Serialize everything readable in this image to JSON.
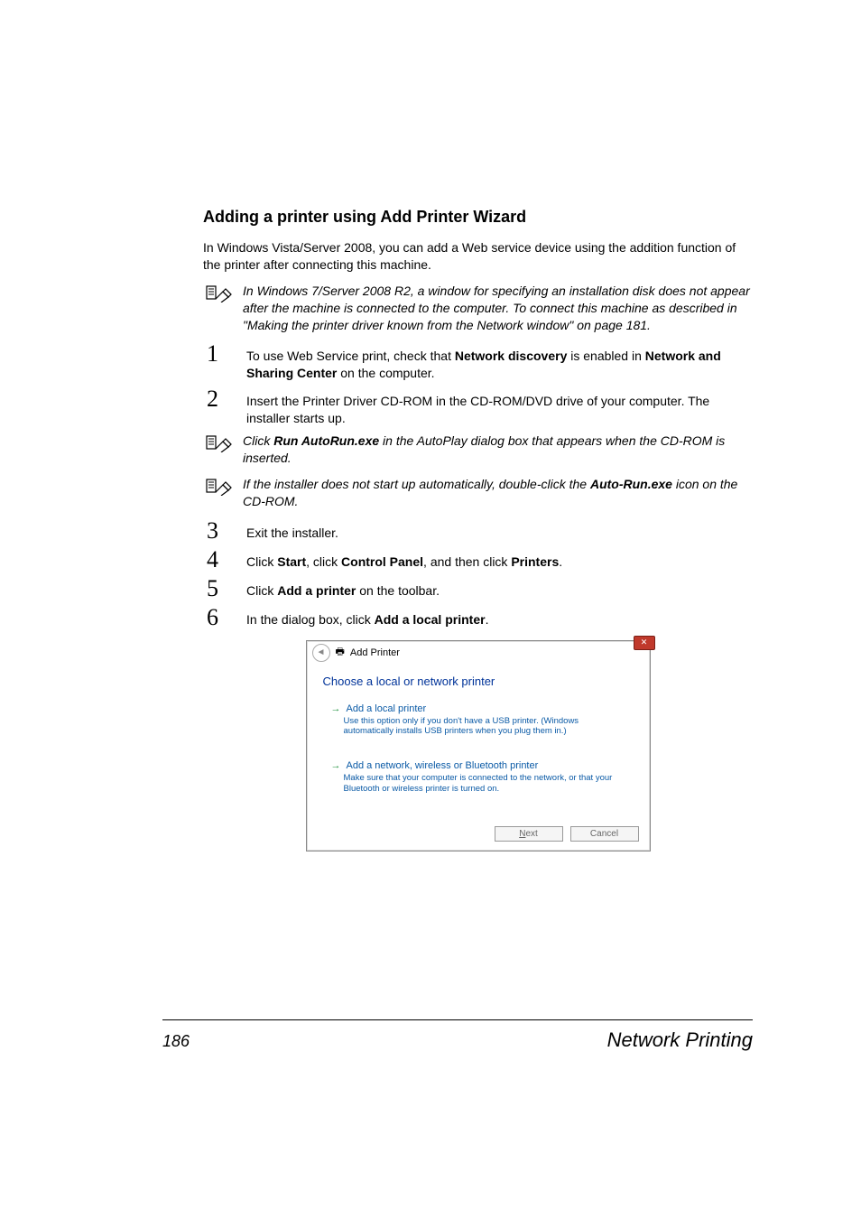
{
  "heading": "Adding a printer using Add Printer Wizard",
  "intro": "In Windows Vista/Server 2008, you can add a Web service device using the addition function of the printer after connecting this machine.",
  "notes": {
    "n1_a": "In Windows 7/Server 2008 R2, a window for specifying an installation disk does not appear after the machine is connected to the computer. To connect this machine as described in \"Making the printer driver known from the Network window\" on page 181.",
    "n2_a": "Click ",
    "n2_b": "Run AutoRun.exe",
    "n2_c": " in the AutoPlay dialog box that appears when the CD-ROM is inserted.",
    "n3_a": "If the installer does not start up automatically, double-click the ",
    "n3_b": "Auto-Run.exe",
    "n3_c": " icon on the CD-ROM."
  },
  "steps": {
    "s1_num": "1",
    "s1_a": "To use Web Service print, check that ",
    "s1_b1": "Network discovery",
    "s1_c": " is enabled in ",
    "s1_b2": "Network and Sharing Center",
    "s1_d": " on the computer.",
    "s2_num": "2",
    "s2_a": "Insert the Printer Driver CD-ROM in the CD-ROM/DVD drive of your computer. The installer starts up.",
    "s3_num": "3",
    "s3_a": "Exit the installer.",
    "s4_num": "4",
    "s4_a": "Click ",
    "s4_b1": "Start",
    "s4_c": ", click ",
    "s4_b2": "Control Panel",
    "s4_d": ", and then click ",
    "s4_b3": "Printers",
    "s4_e": ".",
    "s5_num": "5",
    "s5_a": "Click ",
    "s5_b1": "Add a printer",
    "s5_c": " on the toolbar.",
    "s6_num": "6",
    "s6_a": "In the dialog box, click ",
    "s6_b1": "Add a local printer",
    "s6_c": "."
  },
  "dialog": {
    "title": "Add Printer",
    "heading": "Choose a local or network printer",
    "opt1_title": "Add a local printer",
    "opt1_desc": "Use this option only if you don't have a USB printer. (Windows automatically installs USB printers when you plug them in.)",
    "opt2_title": "Add a network, wireless or Bluetooth printer",
    "opt2_desc": "Make sure that your computer is connected to the network, or that your Bluetooth or wireless printer is turned on.",
    "next": "Next",
    "cancel": "Cancel"
  },
  "footer": {
    "page": "186",
    "title": "Network Printing"
  }
}
